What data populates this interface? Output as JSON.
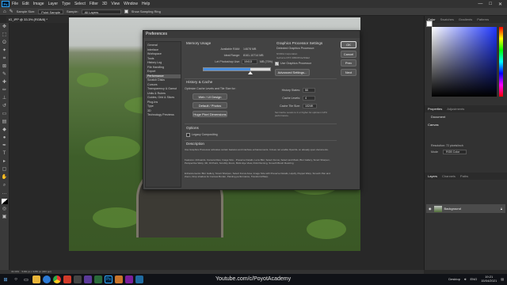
{
  "menubar": {
    "logo": "Ps",
    "items": [
      "File",
      "Edit",
      "Image",
      "Layer",
      "Type",
      "Select",
      "Filter",
      "3D",
      "View",
      "Window",
      "Help"
    ],
    "window_controls": [
      "—",
      "□",
      "✕"
    ]
  },
  "optionsbar": {
    "sample_size_label": "Sample Size:",
    "sample_size_value": "Point Sample",
    "sample_label": "Sample:",
    "sample_value": "All Layers",
    "show_ring_label": "Show Sampling Ring"
  },
  "document_tab": {
    "title": "IG_IPP @ 33.3% (RGB/8) *"
  },
  "status_bar": {
    "zoom": "33.33%",
    "doc_info": "5184 px x 3456 px (300 ppi)"
  },
  "right_panels": {
    "color_tabs": [
      "Color",
      "Swatches",
      "Gradients",
      "Patterns"
    ],
    "properties_tabs": [
      "Properties",
      "Adjustments"
    ],
    "properties_section": "Document",
    "canvas_label": "Canvas",
    "resolution": "Resolution: 72 pixels/inch",
    "mode_label": "Mode",
    "mode_value": "RGB Color",
    "layers_tabs": [
      "Layers",
      "Channels",
      "Paths"
    ],
    "layer_name": "Background"
  },
  "dialog": {
    "title": "Preferences",
    "nav": [
      "General",
      "Interface",
      "Workspace",
      "Tools",
      "History Log",
      "File Handling",
      "Export",
      "Performance",
      "Scratch Disks",
      "Cursors",
      "Transparency & Gamut",
      "Units & Rulers",
      "Guides, Grid & Slices",
      "Plug-Ins",
      "Type",
      "3D",
      "Technology Previews"
    ],
    "nav_selected": 7,
    "memory": {
      "heading": "Memory Usage",
      "available_label": "Available RAM:",
      "available_value": "14678 MB",
      "ideal_label": "Ideal Range:",
      "ideal_value": "8161-10714 MB",
      "let_label": "Let Photoshop Use:",
      "let_value": "10413",
      "let_unit": "MB (70%)",
      "slider_fraction": 0.7
    },
    "gpu": {
      "heading": "Graphics Processor Settings",
      "detected_label": "Detected Graphics Processor:",
      "detected_1": "NVIDIA Corporation",
      "detected_2": "GeForce RTX 3050/PCIe/SSE2",
      "use_label": "Use Graphics Processor",
      "advanced_label": "Advanced Settings..."
    },
    "history": {
      "heading": "History & Cache",
      "optimize_text": "Optimize Cache Levels and Tile Size for:",
      "btn_web": "Web / UI Design",
      "btn_default": "Default / Photos",
      "btn_huge": "Huge Pixel Dimensions",
      "states_label": "History States:",
      "states_value": "50",
      "levels_label": "Cache Levels:",
      "levels_value": "4",
      "tile_label": "Cache Tile Size:",
      "tile_value": "1024K",
      "note": "Set Cache Levels to 2 or higher for optimum GPU performance."
    },
    "options": {
      "heading": "Options",
      "legacy_label": "Legacy Compositing"
    },
    "description": {
      "heading": "Description",
      "p1": "Use Graphics Processor activates certain features and interface enhancements. It does not enable OpenGL on already open documents.",
      "p2": "Features: Artboards, Camera Raw, Image Size - Preserve Details, Lens Blur, Select Focus, Select and Mask, Blur Gallery, Smart Sharpen, Perspective Warp, 3D, Oil Paint, Scrubby Zoom, Birds Eye View, Flick Panning, Smooth Brush Resizing",
      "p3": "Enhancements: Blur Gallery, Smart Sharpen, Select Focus Area, Image Size with Preserve Details, Liquify, Puppet Warp, Smooth Pan and Zoom, Drop shadow for Canvas Border, Painting performance, Transform/Warp"
    },
    "buttons": {
      "ok": "OK",
      "cancel": "Cancel",
      "prev": "Prev",
      "next": "Next"
    }
  },
  "taskbar": {
    "watermark": "Youtube.com/c/PoyotAcademy",
    "desktop_label": "Desktop",
    "lang": "ENG",
    "time": "19:21",
    "date": "15/04/2021"
  }
}
